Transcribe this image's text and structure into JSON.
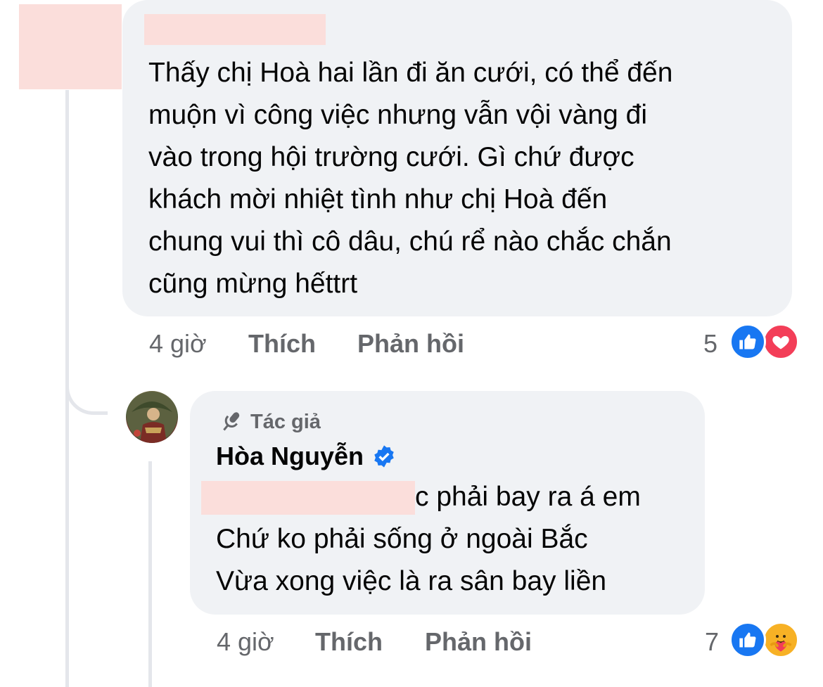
{
  "comment1": {
    "text": "Thấy chị Hoà hai lần đi ăn cưới, có thể đến\nmuộn vì công việc nhưng vẫn vội vàng đi\nvào trong hội trường cưới. Gì chứ được\nkhách mời nhiệt tình như chị Hoà đến\nchung vui thì cô dâu, chú rể nào chắc chắn\ncũng mừng hếttrt",
    "time": "4 giờ",
    "like_label": "Thích",
    "reply_label": "Phản hồi",
    "reaction_count": "5",
    "reactions": [
      "like-icon",
      "love-icon"
    ]
  },
  "reply": {
    "author_badge": "Tác giả",
    "author_name": "Hòa Nguyễn",
    "line1": "c phải bay ra á em",
    "line2": "Chứ ko phải sống ở ngoài Bắc",
    "line3": "Vừa xong việc là ra sân bay liền",
    "time": "4 giờ",
    "like_label": "Thích",
    "reply_label": "Phản hồi",
    "reaction_count": "7",
    "reactions": [
      "like-icon",
      "care-icon"
    ]
  },
  "colors": {
    "bubble": "#f0f2f5",
    "meta_text": "#65676b",
    "like_blue": "#1877f2",
    "love_red": "#f33e58",
    "verified_blue": "#1877f2",
    "redaction": "#fbdedb"
  }
}
